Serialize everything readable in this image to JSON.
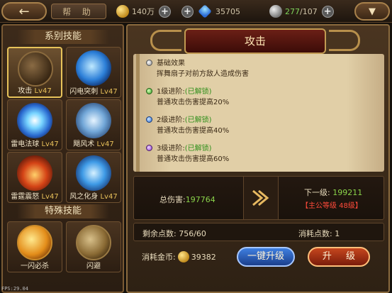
{
  "topbar": {
    "back_icon": "back-arrow-icon",
    "help_label": "帮 助",
    "gold_value": "140万",
    "diamond_value": "35705",
    "stamina_current": "277",
    "stamina_max": "/107",
    "menu_icon": "chevron-down-icon"
  },
  "left": {
    "section_main": "系别技能",
    "section_special": "特殊技能",
    "skills": [
      {
        "name": "攻击",
        "level": "Lv47",
        "icon": "attack-icon"
      },
      {
        "name": "闪电突刺",
        "level": "Lv47",
        "icon": "lightning-icon"
      },
      {
        "name": "雷电法球",
        "level": "Lv47",
        "icon": "lightning-orb-icon"
      },
      {
        "name": "飓风术",
        "level": "Lv47",
        "icon": "tornado-icon"
      },
      {
        "name": "雷霆震怒",
        "level": "Lv47",
        "icon": "thunder-wrath-icon"
      },
      {
        "name": "风之化身",
        "level": "Lv47",
        "icon": "wind-avatar-icon"
      }
    ],
    "special": [
      {
        "name": "一闪必杀",
        "icon": "kill-icon"
      },
      {
        "name": "闪避",
        "icon": "dodge-icon"
      }
    ]
  },
  "right": {
    "title": "攻击",
    "entries": [
      {
        "head": "基础效果",
        "status": "",
        "desc": "挥舞扇子对前方敌人造成伤害"
      },
      {
        "head": "1级进阶:",
        "status": "(已解锁)",
        "desc": "普通攻击伤害提高20%"
      },
      {
        "head": "2级进阶:",
        "status": "(已解锁)",
        "desc": "普通攻击伤害提高40%"
      },
      {
        "head": "3级进阶:",
        "status": "(已解锁)",
        "desc": "普通攻击伤害提高60%"
      }
    ],
    "total_damage_label": "总伤害:",
    "total_damage_value": "197764",
    "next_level_label": "下一级:",
    "next_level_value": "199211",
    "requirement": "【主公等级 48级】",
    "remaining_points": "剩余点数: 756/60",
    "consume_points": "消耗点数: 1",
    "cost_label": "消耗金币:",
    "cost_value": "39382",
    "one_key_button": "一键升级",
    "upgrade_button": "升 级"
  },
  "fps": "FPS:29.04"
}
